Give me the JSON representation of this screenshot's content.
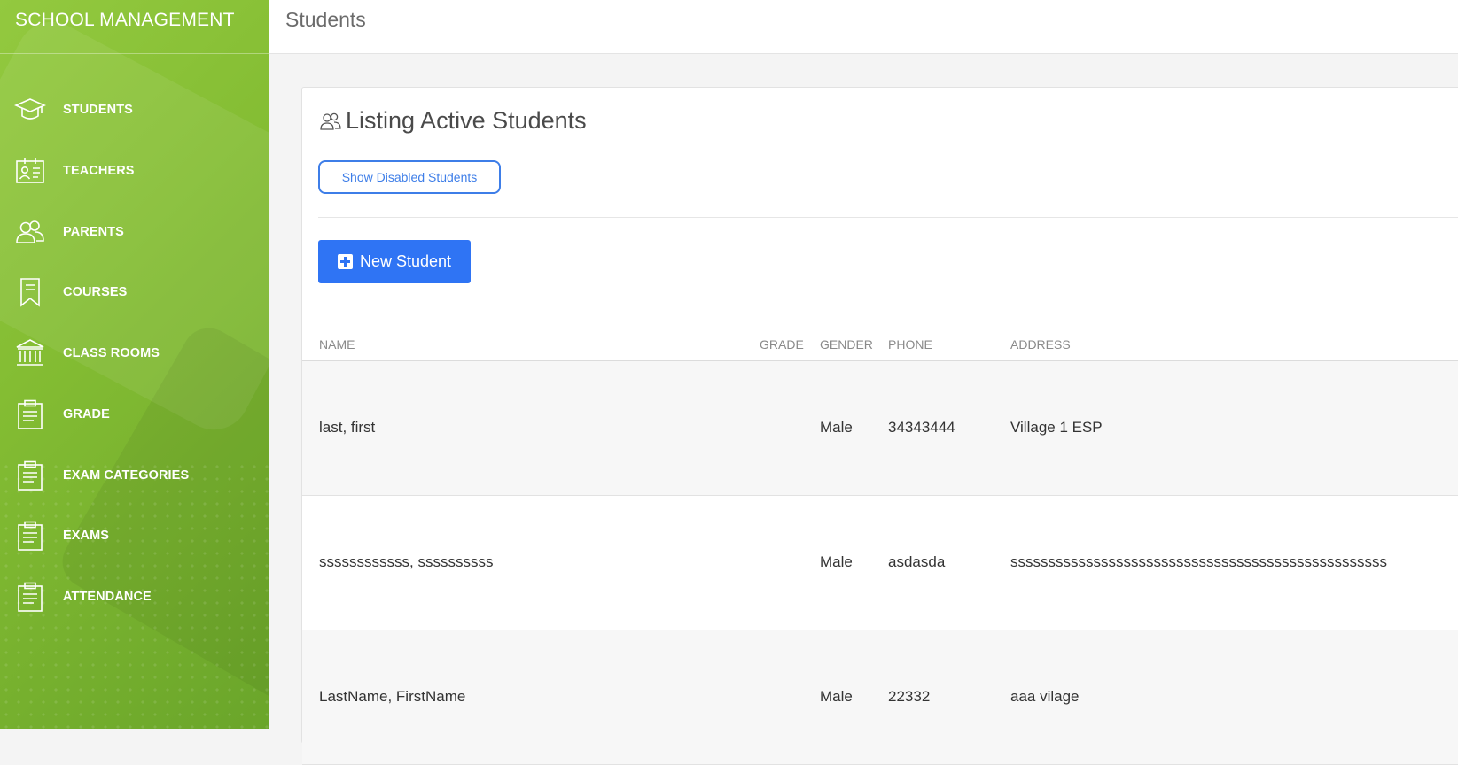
{
  "app": {
    "brand": "SCHOOL MANAGEMENT"
  },
  "sidebar": {
    "items": [
      {
        "label": "STUDENTS",
        "icon": "graduation-cap-icon"
      },
      {
        "label": "TEACHERS",
        "icon": "id-card-icon"
      },
      {
        "label": "PARENTS",
        "icon": "users-icon"
      },
      {
        "label": "COURSES",
        "icon": "bookmark-icon"
      },
      {
        "label": "CLASS ROOMS",
        "icon": "institution-icon"
      },
      {
        "label": "GRADE",
        "icon": "clipboard-icon"
      },
      {
        "label": "EXAM CATEGORIES",
        "icon": "clipboard-icon"
      },
      {
        "label": "EXAMS",
        "icon": "clipboard-icon"
      },
      {
        "label": "ATTENDANCE",
        "icon": "clipboard-icon"
      }
    ]
  },
  "header": {
    "title": "Students"
  },
  "main": {
    "card_title": "Listing Active Students",
    "card_icon": "users-icon",
    "show_disabled_label": "Show Disabled Students",
    "new_student_label": "New Student",
    "table": {
      "columns": [
        "NAME",
        "GRADE",
        "GENDER",
        "PHONE",
        "ADDRESS"
      ],
      "rows": [
        {
          "name": "last, first",
          "grade": "",
          "gender": "Male",
          "phone": "34343444",
          "address": "Village 1 ESP"
        },
        {
          "name": "ssssssssssss, ssssssssss",
          "grade": "",
          "gender": "Male",
          "phone": "asdasda",
          "address": "ssssssssssssssssssssssssssssssssssssssssssssssssss"
        },
        {
          "name": "LastName, FirstName",
          "grade": "",
          "gender": "Male",
          "phone": "22332",
          "address": "aaa vilage"
        }
      ]
    }
  },
  "colors": {
    "sidebar_green": "#84bd33",
    "primary_blue": "#2f74f4",
    "outline_blue": "#3e7ee8"
  }
}
